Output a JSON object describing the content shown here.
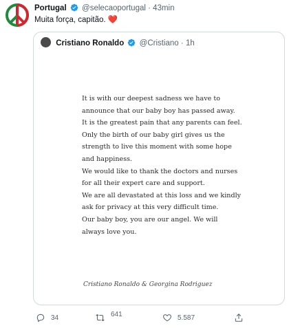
{
  "tweet": {
    "author_name": "Portugal",
    "handle": "@selecaoportugal",
    "separator": "·",
    "time": "43min",
    "text": "Muita força, capitão.",
    "emoji": "❤️"
  },
  "quoted_tweet": {
    "author_name": "Cristiano Ronaldo",
    "handle": "@Cristiano",
    "separator": "·",
    "time": "1h",
    "statement_lines": [
      "It is with our deepest sadness we have to",
      "announce that our baby boy has passed away.",
      "It is the greatest pain that any parents can feel.",
      "Only the birth of our baby girl gives us the",
      "strength to live this moment with some hope",
      "and happiness.",
      "We would like to thank the doctors and nurses",
      "for all their expert care and support.",
      "We are all devastated at this loss and we kindly",
      "ask for privacy at this very difficult time.",
      "Our baby boy, you are our angel. We will",
      "always love you."
    ],
    "signature": "Cristiano Ronaldo & Georgina Rodriguez"
  },
  "actions": {
    "replies": "34",
    "retweets": "641",
    "likes": "5.587"
  },
  "colors": {
    "verified": "#1d9bf0",
    "heart": "#e0245e",
    "muted": "#536471",
    "border": "#cfd9de"
  }
}
